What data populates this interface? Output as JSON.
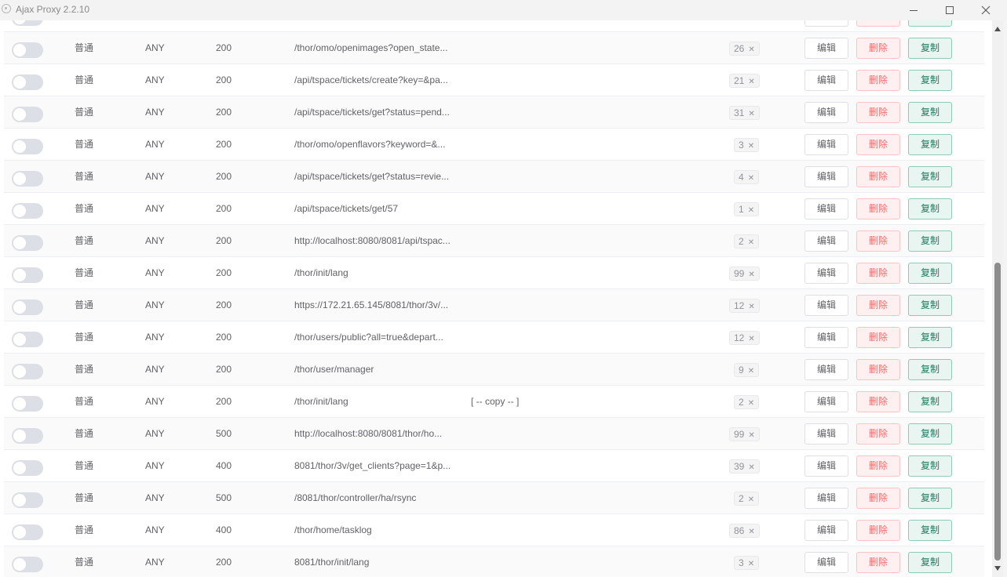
{
  "window": {
    "title": "Ajax Proxy 2.2.10"
  },
  "actions": {
    "edit": "编辑",
    "delete": "删除",
    "copy": "复制"
  },
  "rows": [
    {
      "type": "普通",
      "method": "ANY",
      "status": "200",
      "url": "",
      "remark": "",
      "count": ""
    },
    {
      "type": "普通",
      "method": "ANY",
      "status": "200",
      "url": "/thor/omo/openimages?open_state...",
      "remark": "",
      "count": "26"
    },
    {
      "type": "普通",
      "method": "ANY",
      "status": "200",
      "url": "/api/tspace/tickets/create?key=&pa...",
      "remark": "",
      "count": "21"
    },
    {
      "type": "普通",
      "method": "ANY",
      "status": "200",
      "url": "/api/tspace/tickets/get?status=pend...",
      "remark": "",
      "count": "31"
    },
    {
      "type": "普通",
      "method": "ANY",
      "status": "200",
      "url": "/thor/omo/openflavors?keyword=&...",
      "remark": "",
      "count": "3"
    },
    {
      "type": "普通",
      "method": "ANY",
      "status": "200",
      "url": "/api/tspace/tickets/get?status=revie...",
      "remark": "",
      "count": "4"
    },
    {
      "type": "普通",
      "method": "ANY",
      "status": "200",
      "url": "/api/tspace/tickets/get/57",
      "remark": "",
      "count": "1"
    },
    {
      "type": "普通",
      "method": "ANY",
      "status": "200",
      "url": "http://localhost:8080/8081/api/tspac...",
      "remark": "",
      "count": "2"
    },
    {
      "type": "普通",
      "method": "ANY",
      "status": "200",
      "url": "/thor/init/lang",
      "remark": "",
      "count": "99"
    },
    {
      "type": "普通",
      "method": "ANY",
      "status": "200",
      "url": "https://172.21.65.145/8081/thor/3v/...",
      "remark": "",
      "count": "12"
    },
    {
      "type": "普通",
      "method": "ANY",
      "status": "200",
      "url": "/thor/users/public?all=true&depart...",
      "remark": "",
      "count": "12"
    },
    {
      "type": "普通",
      "method": "ANY",
      "status": "200",
      "url": "/thor/user/manager",
      "remark": "",
      "count": "9"
    },
    {
      "type": "普通",
      "method": "ANY",
      "status": "200",
      "url": "/thor/init/lang",
      "remark": "[ -- copy -- ]",
      "count": "2"
    },
    {
      "type": "普通",
      "method": "ANY",
      "status": "500",
      "url": "http://localhost:8080/8081/thor/ho...",
      "remark": "",
      "count": "99"
    },
    {
      "type": "普通",
      "method": "ANY",
      "status": "400",
      "url": "8081/thor/3v/get_clients?page=1&p...",
      "remark": "",
      "count": "39"
    },
    {
      "type": "普通",
      "method": "ANY",
      "status": "500",
      "url": "/8081/thor/controller/ha/rsync",
      "remark": "",
      "count": "2"
    },
    {
      "type": "普通",
      "method": "ANY",
      "status": "400",
      "url": "/thor/home/tasklog",
      "remark": "",
      "count": "86"
    },
    {
      "type": "普通",
      "method": "ANY",
      "status": "200",
      "url": "8081/thor/init/lang",
      "remark": "",
      "count": "3"
    }
  ]
}
